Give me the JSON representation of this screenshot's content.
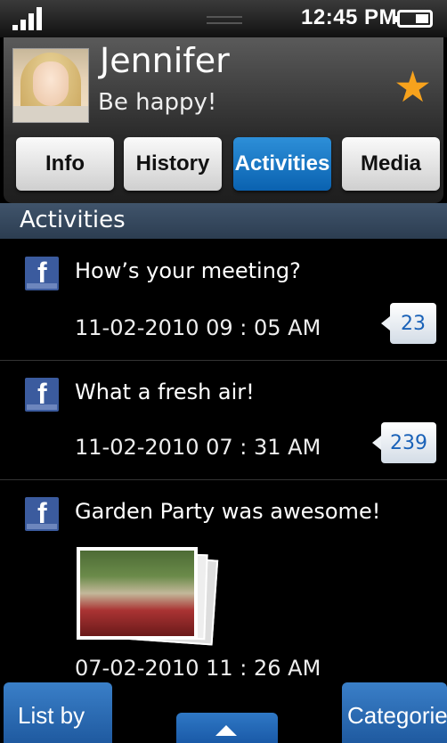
{
  "status_bar": {
    "time": "12:45 PM"
  },
  "profile": {
    "name": "Jennifer",
    "status": "Be happy!"
  },
  "tabs": [
    {
      "label": "Info"
    },
    {
      "label": "History"
    },
    {
      "label": "Activities",
      "active": true
    },
    {
      "label": "Media"
    }
  ],
  "section": {
    "title": "Activities"
  },
  "activities": [
    {
      "source_icon": "facebook-icon",
      "message": "How’s your meeting?",
      "timestamp": "11-02-2010 09 : 05 AM",
      "comments": "23"
    },
    {
      "source_icon": "facebook-icon",
      "message": "What a fresh air!",
      "timestamp": "11-02-2010 07 : 31 AM",
      "comments": "239"
    },
    {
      "source_icon": "facebook-icon",
      "message": "Garden Party was awesome!",
      "timestamp": "07-02-2010 11 : 26 AM",
      "has_photos": true
    }
  ],
  "bottom_bar": {
    "left_label": "List by",
    "right_label": "Categorie"
  },
  "colors": {
    "accent_blue": "#0a62b0",
    "section_bg": "#2c3d51",
    "star": "#f7a21c",
    "facebook": "#3b5b9e"
  }
}
